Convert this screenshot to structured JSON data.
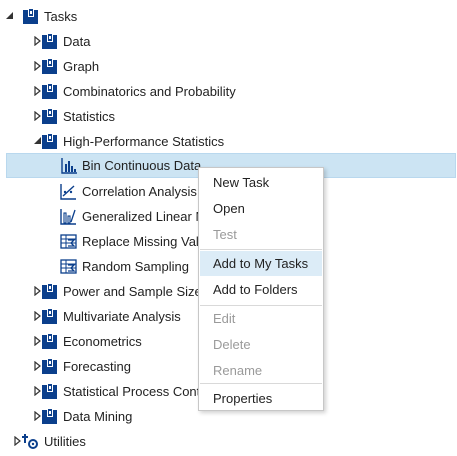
{
  "tree": {
    "root": {
      "label": "Tasks",
      "icon": "task-folder-icon",
      "expanded": true
    },
    "items": [
      {
        "label": "Data",
        "icon": "task-folder-icon",
        "expanded": false
      },
      {
        "label": "Graph",
        "icon": "task-folder-icon",
        "expanded": false
      },
      {
        "label": "Combinatorics and Probability",
        "icon": "task-folder-icon",
        "expanded": false
      },
      {
        "label": "Statistics",
        "icon": "task-folder-icon",
        "expanded": false
      },
      {
        "label": "High-Performance Statistics",
        "icon": "task-folder-icon",
        "expanded": true,
        "children": [
          {
            "label": "Bin Continuous Data",
            "icon": "histogram-icon",
            "selected": true
          },
          {
            "label": "Correlation Analysis",
            "icon": "scatter-chart-icon"
          },
          {
            "label": "Generalized Linear M",
            "icon": "glm-chart-icon"
          },
          {
            "label": "Replace Missing Valu",
            "icon": "table-sum-icon"
          },
          {
            "label": "Random Sampling",
            "icon": "table-sum-icon"
          }
        ]
      },
      {
        "label": "Power and Sample Size",
        "icon": "task-folder-icon",
        "expanded": false
      },
      {
        "label": "Multivariate Analysis",
        "icon": "task-folder-icon",
        "expanded": false
      },
      {
        "label": "Econometrics",
        "icon": "task-folder-icon",
        "expanded": false
      },
      {
        "label": "Forecasting",
        "icon": "task-folder-icon",
        "expanded": false
      },
      {
        "label": "Statistical Process Contr",
        "icon": "task-folder-icon",
        "expanded": false
      },
      {
        "label": "Data Mining",
        "icon": "task-folder-icon",
        "expanded": false
      }
    ],
    "utilities": {
      "label": "Utilities",
      "icon": "utilities-icon",
      "expanded": false
    }
  },
  "context_menu": {
    "items": [
      {
        "label": "New Task",
        "enabled": true
      },
      {
        "label": "Open",
        "enabled": true
      },
      {
        "label": "Test",
        "enabled": false
      },
      {
        "separator": true
      },
      {
        "label": "Add to My Tasks",
        "enabled": true,
        "hover": true
      },
      {
        "label": "Add to Folders",
        "enabled": true
      },
      {
        "separator": true
      },
      {
        "label": "Edit",
        "enabled": false
      },
      {
        "label": "Delete",
        "enabled": false
      },
      {
        "label": "Rename",
        "enabled": false
      },
      {
        "separator": true
      },
      {
        "label": "Properties",
        "enabled": true
      }
    ]
  },
  "colors": {
    "folder_icon": "#0b3f8c",
    "selected_row": "#cce4f3",
    "menu_hover": "#dcecf7",
    "disabled_text": "#9a9a9a"
  }
}
